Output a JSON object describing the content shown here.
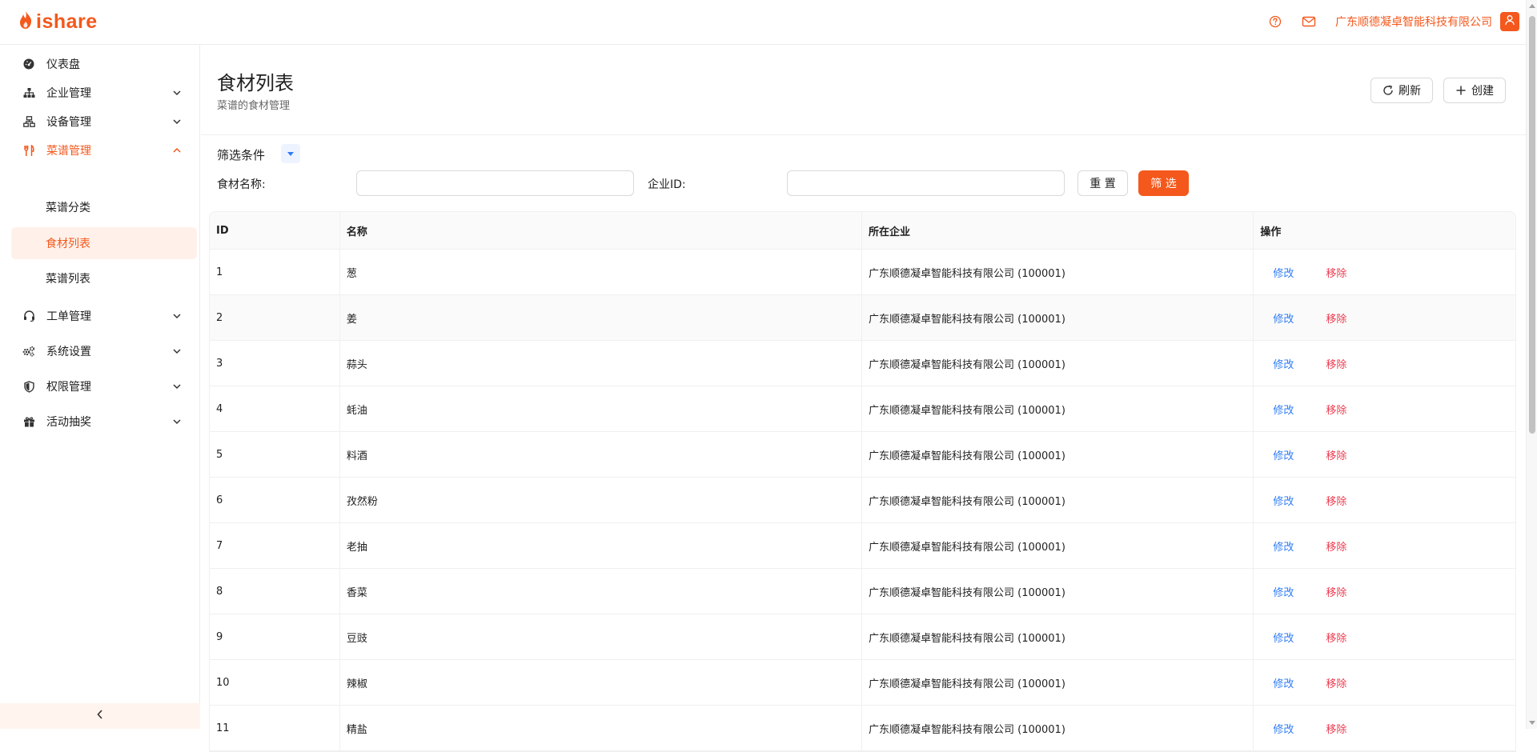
{
  "brand": {
    "name": "ishare",
    "accent": "#f4581c"
  },
  "topbar": {
    "company": "广东顺德凝卓智能科技有限公司",
    "icons": [
      "help-icon",
      "mail-icon",
      "user-icon"
    ]
  },
  "sidebar": {
    "items": [
      {
        "label": "仪表盘",
        "icon": "dashboard-icon"
      },
      {
        "label": "企业管理",
        "icon": "org-icon"
      },
      {
        "label": "设备管理",
        "icon": "device-icon"
      },
      {
        "label": "菜谱管理",
        "icon": "utensils-icon"
      },
      {
        "label": "工单管理",
        "icon": "headset-icon"
      },
      {
        "label": "系统设置",
        "icon": "gears-icon"
      },
      {
        "label": "权限管理",
        "icon": "shield-icon"
      },
      {
        "label": "活动抽奖",
        "icon": "gift-icon"
      }
    ],
    "sub_items": [
      {
        "label": "菜谱分类"
      },
      {
        "label": "食材列表"
      },
      {
        "label": "菜谱列表"
      }
    ]
  },
  "page": {
    "title": "食材列表",
    "subtitle": "菜谱的食材管理",
    "refresh_label": "刷新",
    "create_label": "创建"
  },
  "filter": {
    "title": "筛选条件",
    "name_label": "食材名称:",
    "name_value": "",
    "company_label": "企业ID:",
    "company_value": "",
    "reset_label": "重 置",
    "submit_label": "筛 选"
  },
  "table": {
    "columns": [
      "ID",
      "名称",
      "所在企业",
      "操作"
    ],
    "edit_label": "修改",
    "delete_label": "移除",
    "rows": [
      {
        "id": "1",
        "name": "葱",
        "company": "广东顺德凝卓智能科技有限公司 (100001)"
      },
      {
        "id": "2",
        "name": "姜",
        "company": "广东顺德凝卓智能科技有限公司 (100001)"
      },
      {
        "id": "3",
        "name": "蒜头",
        "company": "广东顺德凝卓智能科技有限公司 (100001)"
      },
      {
        "id": "4",
        "name": "蚝油",
        "company": "广东顺德凝卓智能科技有限公司 (100001)"
      },
      {
        "id": "5",
        "name": "料酒",
        "company": "广东顺德凝卓智能科技有限公司 (100001)"
      },
      {
        "id": "6",
        "name": "孜然粉",
        "company": "广东顺德凝卓智能科技有限公司 (100001)"
      },
      {
        "id": "7",
        "name": "老抽",
        "company": "广东顺德凝卓智能科技有限公司 (100001)"
      },
      {
        "id": "8",
        "name": "香菜",
        "company": "广东顺德凝卓智能科技有限公司 (100001)"
      },
      {
        "id": "9",
        "name": "豆豉",
        "company": "广东顺德凝卓智能科技有限公司 (100001)"
      },
      {
        "id": "10",
        "name": "辣椒",
        "company": "广东顺德凝卓智能科技有限公司 (100001)"
      },
      {
        "id": "11",
        "name": "精盐",
        "company": "广东顺德凝卓智能科技有限公司 (100001)"
      }
    ]
  }
}
